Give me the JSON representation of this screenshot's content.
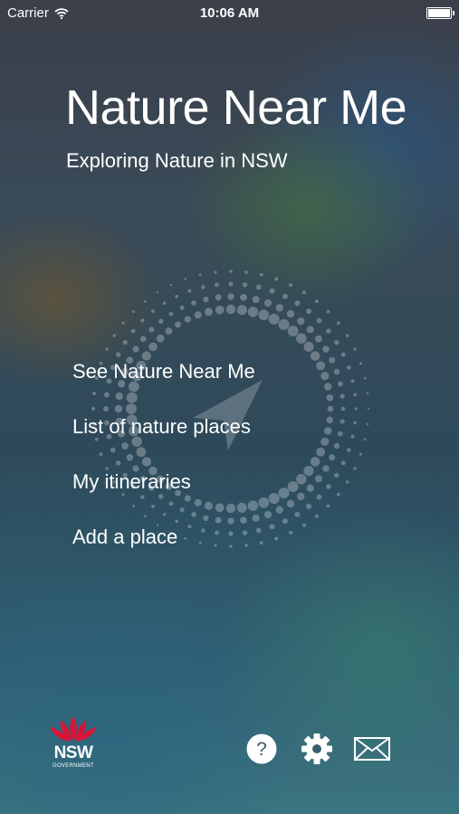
{
  "status_bar": {
    "carrier": "Carrier",
    "time": "10:06 AM",
    "battery_level": 1.0
  },
  "header": {
    "title": "Nature Near Me",
    "subtitle": "Exploring Nature in NSW"
  },
  "menu": {
    "items": [
      {
        "label": "See Nature Near Me"
      },
      {
        "label": "List of nature places"
      },
      {
        "label": "My itineraries"
      },
      {
        "label": "Add a place"
      }
    ]
  },
  "footer": {
    "logo": {
      "text": "NSW",
      "subtext": "GOVERNMENT",
      "color": "#d7153a"
    },
    "icons": [
      "help-icon",
      "settings-gear-icon",
      "mail-icon"
    ]
  }
}
